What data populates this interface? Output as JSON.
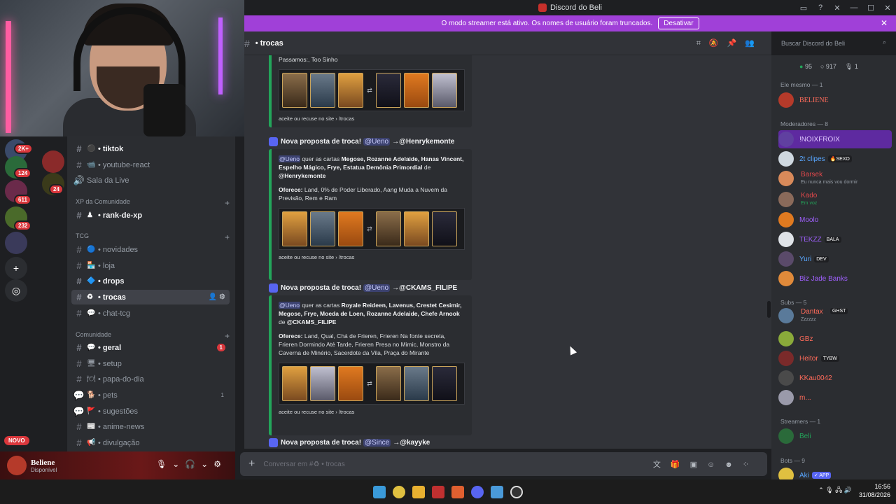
{
  "window": {
    "title": "Discord do Beli"
  },
  "banner": {
    "text": "O modo streamer está ativo. Os nomes de usuário foram truncados.",
    "button": "Desativar"
  },
  "rail": {
    "badges": [
      "2K+",
      "124",
      "611",
      "232",
      "24"
    ],
    "new_label": "NOVO"
  },
  "channels": {
    "items": [
      {
        "name": "• tiktok",
        "emoji": "⚫"
      },
      {
        "name": "• youtube-react",
        "emoji": "📹"
      },
      {
        "name": "Sala da Live",
        "emoji": ""
      },
      {
        "name": "• rank-de-xp",
        "emoji": "♟"
      },
      {
        "name": "• novidades",
        "emoji": "🔵"
      },
      {
        "name": "• loja",
        "emoji": "🏪"
      },
      {
        "name": "• drops",
        "emoji": "🔷"
      },
      {
        "name": "• trocas",
        "emoji": "♻"
      },
      {
        "name": "• chat-tcg",
        "emoji": "💬"
      },
      {
        "name": "• geral",
        "emoji": "💬"
      },
      {
        "name": "• setup",
        "emoji": "🖥"
      },
      {
        "name": "• papa-do-dia",
        "emoji": "🍽"
      },
      {
        "name": "• pets",
        "emoji": "🐕"
      },
      {
        "name": "• sugestões",
        "emoji": "🚩"
      },
      {
        "name": "• anime-news",
        "emoji": "📰"
      },
      {
        "name": "• divulgação",
        "emoji": "📢"
      }
    ],
    "categories": [
      "XP da Comunidade",
      "TCG",
      "Comunidade"
    ],
    "geral_unread": "1",
    "pets_count": "1"
  },
  "user": {
    "name": "Beliene",
    "status": "Disponível"
  },
  "chat_header": {
    "channel": "• trocas",
    "search_placeholder": "Buscar Discord do Beli"
  },
  "chat": {
    "top_fragment": "Passamos:, Too Sinho",
    "footer": "aceite ou recuse no site › /trocas",
    "messages": [
      {
        "title": "Nova proposta de troca!",
        "from": "@Ueno",
        "to": "@Henrykemonte",
        "request_mention": "@Ueno",
        "request_text": "quer as cartas",
        "request_cards": "Megose, Rozanne Adelaide, Hanas Vincent, Espelho Mágico, Frye, Estatua Demônia Primordial",
        "request_de": "de",
        "request_target": "@Henrykemonte",
        "offer_label": "Oferece:",
        "offer": "Land, 0% de Poder Liberado, Aang Muda a Nuvem da Previsão, Rem e Ram"
      },
      {
        "title": "Nova proposta de troca!",
        "from": "@Ueno",
        "to": "@CKAMS_FILIPE",
        "request_mention": "@Ueno",
        "request_text": "quer as cartas",
        "request_cards": "Royale Reideen, Lavenus, Crestet Cesimir, Megose, Frye, Moeda de Loen, Rozanne Adelaide, Chefe Arnook",
        "request_de": "de",
        "request_target": "@CKAMS_FILIPE",
        "offer_label": "Oferece:",
        "offer": "Land, Qual, Chá de Frieren, Frieren Na fonte secreta, Frieren Dormindo Até Tarde, Frieren Presa no Mimic, Monstro da Caverna de Minério, Sacerdote da Vila, Praça do Mirante"
      },
      {
        "title": "Nova proposta de troca!",
        "from": "@Since",
        "to": "@kayyke"
      }
    ],
    "input_placeholder": "Conversar em #♻ • trocas"
  },
  "members": {
    "stats": {
      "online": "95",
      "offline": "917",
      "voice": "1"
    },
    "groups": [
      {
        "label": "Ele mesmo — 1",
        "items": [
          {
            "name": "BELIENE",
            "color": "#ff6b5a",
            "tag": "",
            "sub": ""
          }
        ]
      },
      {
        "label": "Moderadores — 8",
        "items": [
          {
            "name": "!NOIXFROIX",
            "color": "#c49bff",
            "tag": "",
            "sub": ""
          },
          {
            "name": "2t clipes",
            "color": "#58a6ff",
            "tag": "🔥SEXO",
            "sub": ""
          },
          {
            "name": "Barsek",
            "color": "#e0484b",
            "tag": "",
            "sub": "Eu nunca mais vou dormir"
          },
          {
            "name": "Kado",
            "color": "#e0484b",
            "tag": "",
            "sub": "Em voz"
          },
          {
            "name": "Moolo",
            "color": "#a060ff",
            "tag": "",
            "sub": ""
          },
          {
            "name": "TEKZZ",
            "color": "#a060ff",
            "tag": "BALA",
            "sub": ""
          },
          {
            "name": "Yuri",
            "color": "#58a6ff",
            "tag": "DEV",
            "sub": ""
          },
          {
            "name": "Biz Jade Banks",
            "color": "#a060ff",
            "tag": "",
            "sub": ""
          }
        ]
      },
      {
        "label": "Subs — 5",
        "items": [
          {
            "name": "Dantax",
            "color": "#ff6b5a",
            "tag": "GHST",
            "sub": "Zzzzzz"
          },
          {
            "name": "GBz",
            "color": "#ff6b5a",
            "tag": "",
            "sub": ""
          },
          {
            "name": "Heitor",
            "color": "#ff6b5a",
            "tag": "TYBW",
            "sub": ""
          },
          {
            "name": "KKau0042",
            "color": "#ff6b5a",
            "tag": "",
            "sub": ""
          },
          {
            "name": "m...",
            "color": "#ff6b5a",
            "tag": "",
            "sub": ""
          }
        ]
      },
      {
        "label": "Streamers — 1",
        "items": [
          {
            "name": "Beli",
            "color": "#23a55a",
            "tag": "",
            "sub": ""
          }
        ]
      },
      {
        "label": "Bots — 9",
        "items": [
          {
            "name": "Aki",
            "color": "#58a6ff",
            "tag": "✓ APP",
            "sub": ""
          }
        ]
      }
    ]
  },
  "taskbar": {
    "time": "16:56",
    "date": "31/08/2026"
  }
}
